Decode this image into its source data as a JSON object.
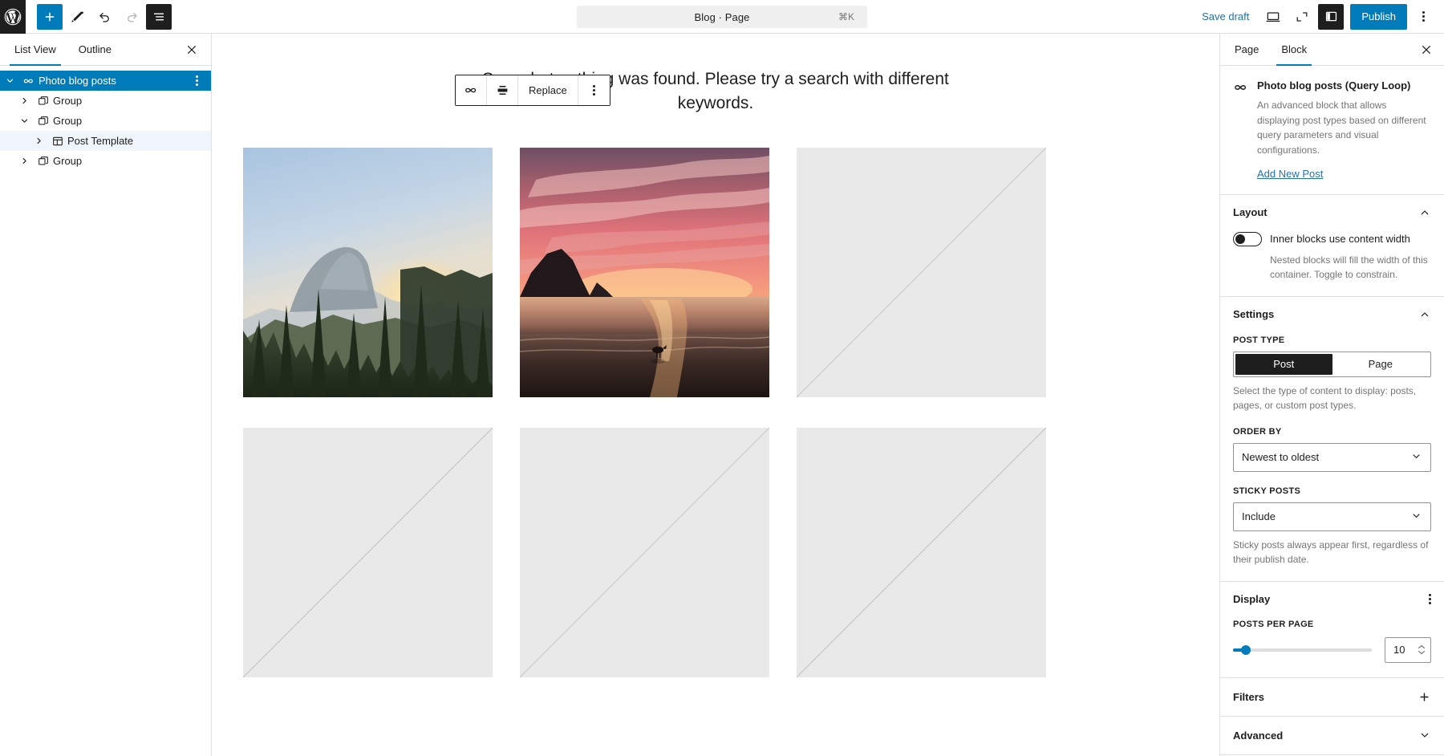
{
  "header": {
    "logo_icon": "wordpress-logo-icon",
    "add_block_label": "+",
    "tools": [
      {
        "name": "add-block-button",
        "icon": "plus-icon"
      },
      {
        "name": "tools-button",
        "icon": "pencil-icon"
      },
      {
        "name": "undo-button",
        "icon": "undo-arrow-icon"
      },
      {
        "name": "redo-button",
        "icon": "redo-arrow-icon"
      },
      {
        "name": "list-view-button",
        "icon": "list-view-icon"
      }
    ],
    "document_title": "Blog · Page",
    "document_shortcut": "⌘K",
    "save_draft_label": "Save draft",
    "preview_icon": "desktop-preview-icon",
    "zoom_out_icon": "zoom-out-icon",
    "sidebar_toggle_icon": "settings-sidebar-icon",
    "publish_label": "Publish",
    "options_icon": "more-options-icon"
  },
  "list_view": {
    "tabs": [
      {
        "label": "List View",
        "active": true
      },
      {
        "label": "Outline",
        "active": false
      }
    ],
    "close_icon": "close-icon",
    "rows": [
      {
        "label": "Photo blog posts",
        "icon": "query-loop-icon",
        "indent": 0,
        "expanded": true,
        "selected": true,
        "has_more": true
      },
      {
        "label": "Group",
        "icon": "group-icon",
        "indent": 1,
        "expanded": false,
        "selected": false,
        "has_more": false
      },
      {
        "label": "Group",
        "icon": "group-icon",
        "indent": 1,
        "expanded": true,
        "selected": false,
        "has_more": false
      },
      {
        "label": "Post Template",
        "icon": "post-template-icon",
        "indent": 2,
        "expanded": false,
        "selected": false,
        "has_more": false
      },
      {
        "label": "Group",
        "icon": "group-icon",
        "indent": 1,
        "expanded": false,
        "selected": false,
        "has_more": false
      }
    ]
  },
  "canvas": {
    "block_toolbar": {
      "query_loop_icon": "query-loop-icon",
      "align_icon": "align-center-icon",
      "replace_label": "Replace",
      "more_icon": "more-options-icon"
    },
    "notice": "Sorry, but nothing was found. Please try a search with different keywords.",
    "cells": [
      {
        "type": "image",
        "name": "photo-mountain-sunrise"
      },
      {
        "type": "image",
        "name": "photo-beach-sunset"
      },
      {
        "type": "placeholder",
        "name": "image-placeholder"
      },
      {
        "type": "placeholder",
        "name": "image-placeholder"
      },
      {
        "type": "placeholder",
        "name": "image-placeholder"
      },
      {
        "type": "placeholder",
        "name": "image-placeholder"
      }
    ]
  },
  "inspector": {
    "tabs": [
      {
        "label": "Page",
        "active": false
      },
      {
        "label": "Block",
        "active": true
      }
    ],
    "close_icon": "close-icon",
    "block_card": {
      "icon": "query-loop-icon",
      "title": "Photo blog posts (Query Loop)",
      "description": "An advanced block that allows displaying post types based on different query parameters and visual configurations.",
      "link_label": "Add New Post"
    },
    "layout": {
      "title": "Layout",
      "collapse_icon": "chevron-up-icon",
      "toggle_label": "Inner blocks use content width",
      "toggle_on": false,
      "help": "Nested blocks will fill the width of this container. Toggle to constrain."
    },
    "settings": {
      "title": "Settings",
      "collapse_icon": "chevron-up-icon",
      "post_type_label": "Post type",
      "post_type_options": [
        "Post",
        "Page"
      ],
      "post_type_selected": "Post",
      "post_type_help": "Select the type of content to display: posts, pages, or custom post types.",
      "order_by_label": "Order by",
      "order_by_value": "Newest to oldest",
      "sticky_posts_label": "Sticky posts",
      "sticky_posts_value": "Include",
      "sticky_posts_help": "Sticky posts always appear first, regardless of their publish date."
    },
    "display": {
      "title": "Display",
      "menu_icon": "more-options-icon",
      "posts_per_page_label": "Posts per page",
      "posts_per_page_value": "10",
      "slider_percent": 9
    },
    "filters": {
      "title": "Filters",
      "icon": "plus-icon"
    },
    "advanced": {
      "title": "Advanced",
      "icon": "chevron-down-icon"
    }
  },
  "colors": {
    "accent": "#007cba",
    "link": "#2271b1",
    "dark": "#1e1e1e",
    "muted": "#757575",
    "border": "#e0e0e0",
    "placeholder": "#e9e9e9"
  }
}
